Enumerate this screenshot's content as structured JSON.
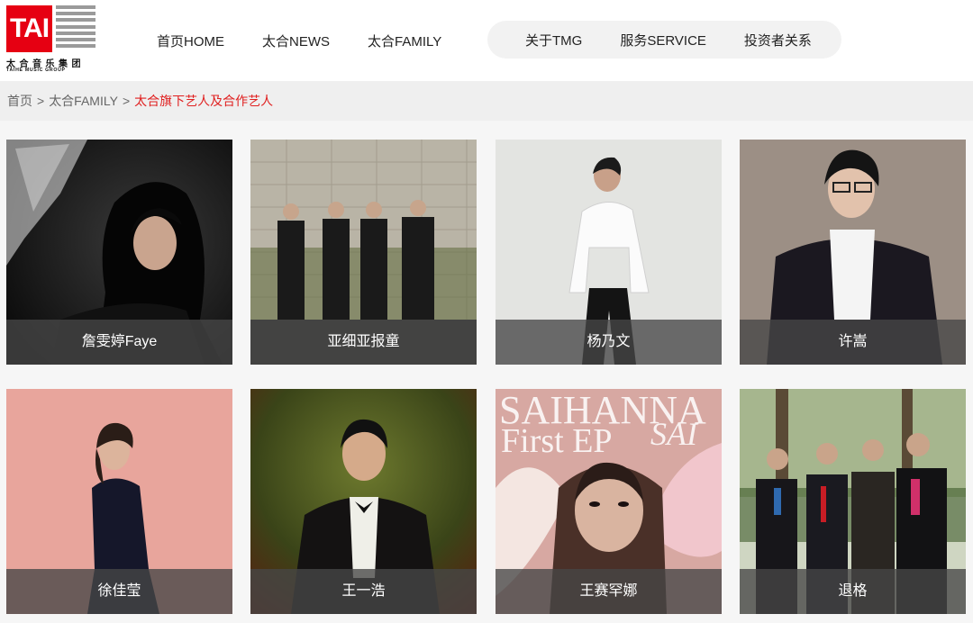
{
  "logo": {
    "mark": "TAI",
    "name_cn": "太合音乐集团",
    "name_en": "TAIHE MUSIC GROUP",
    "brand_color": "#e60012"
  },
  "nav": {
    "left": [
      "首页HOME",
      "太合NEWS",
      "太合FAMILY"
    ],
    "right": [
      "关于TMG",
      "服务SERVICE",
      "投资者关系"
    ]
  },
  "breadcrumb": {
    "items": [
      "首页",
      "太合FAMILY"
    ],
    "separator": ">",
    "current": "太合旗下艺人及合作艺人",
    "current_color": "#e02020"
  },
  "artists": [
    {
      "name": "詹雯婷Faye"
    },
    {
      "name": "亚细亚报童"
    },
    {
      "name": "杨乃文"
    },
    {
      "name": "许嵩"
    },
    {
      "name": "徐佳莹"
    },
    {
      "name": "王一浩"
    },
    {
      "name": "王赛罕娜"
    },
    {
      "name": "退格"
    }
  ],
  "ep_cover": {
    "line1": "SAIHANNA",
    "line2": "First EP",
    "line3": "SAI"
  }
}
